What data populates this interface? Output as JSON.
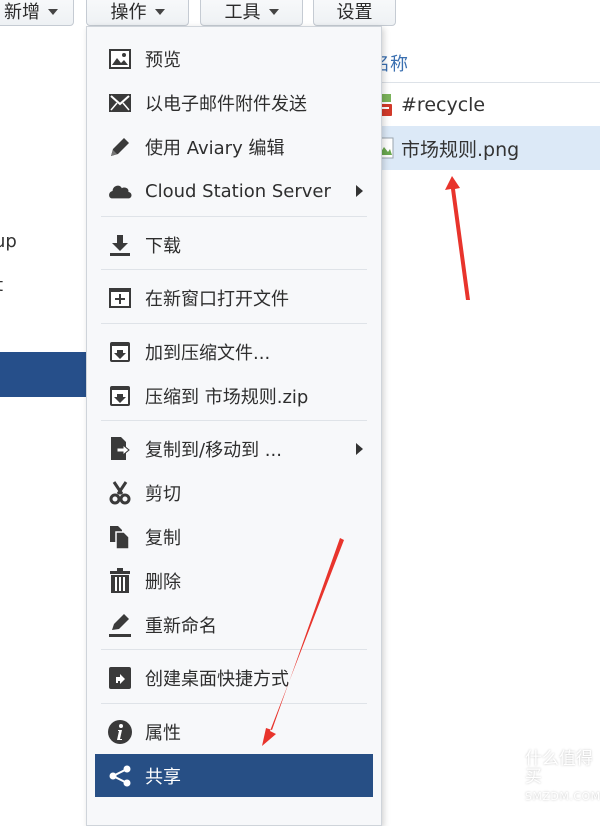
{
  "toolbar": {
    "new_label": "新增",
    "action_label": "操作",
    "tools_label": "工具",
    "settings_label": "设置"
  },
  "left_panel": {
    "item_1": "up",
    "item_2": "t"
  },
  "file_list": {
    "column_name": "名称",
    "rows": [
      {
        "name": "#recycle",
        "selected": false
      },
      {
        "name": "市场规则.png",
        "selected": true
      }
    ]
  },
  "menu": {
    "items": [
      {
        "label": "预览",
        "icon": "image-icon"
      },
      {
        "label": "以电子邮件附件发送",
        "icon": "envelope-icon"
      },
      {
        "label": "使用 Aviary 编辑",
        "icon": "pencil-icon"
      },
      {
        "label": "Cloud Station Server",
        "icon": "cloud-icon",
        "submenu": true
      },
      {
        "label": "下载",
        "icon": "download-icon"
      },
      {
        "label": "在新窗口打开文件",
        "icon": "new-window-icon"
      },
      {
        "label": "加到压缩文件...",
        "icon": "archive-add-icon"
      },
      {
        "label": "压缩到 市场规则.zip",
        "icon": "archive-icon"
      },
      {
        "label": "复制到/移动到 ...",
        "icon": "copy-move-icon",
        "submenu": true
      },
      {
        "label": "剪切",
        "icon": "scissors-icon"
      },
      {
        "label": "复制",
        "icon": "copy-icon"
      },
      {
        "label": "删除",
        "icon": "trash-icon"
      },
      {
        "label": "重新命名",
        "icon": "rename-icon"
      },
      {
        "label": "创建桌面快捷方式",
        "icon": "shortcut-icon"
      },
      {
        "label": "属性",
        "icon": "info-icon"
      },
      {
        "label": "共享",
        "icon": "share-icon",
        "active": true
      }
    ]
  },
  "watermark": {
    "line1": "什么值得买",
    "line2": "SMZDM.COM",
    "logo": "值"
  },
  "colors": {
    "menu_active_bg": "#274f85",
    "left_selected_bg": "#264f8a",
    "file_selected_bg": "#dce9f7",
    "arrow_red": "#e8342c"
  }
}
